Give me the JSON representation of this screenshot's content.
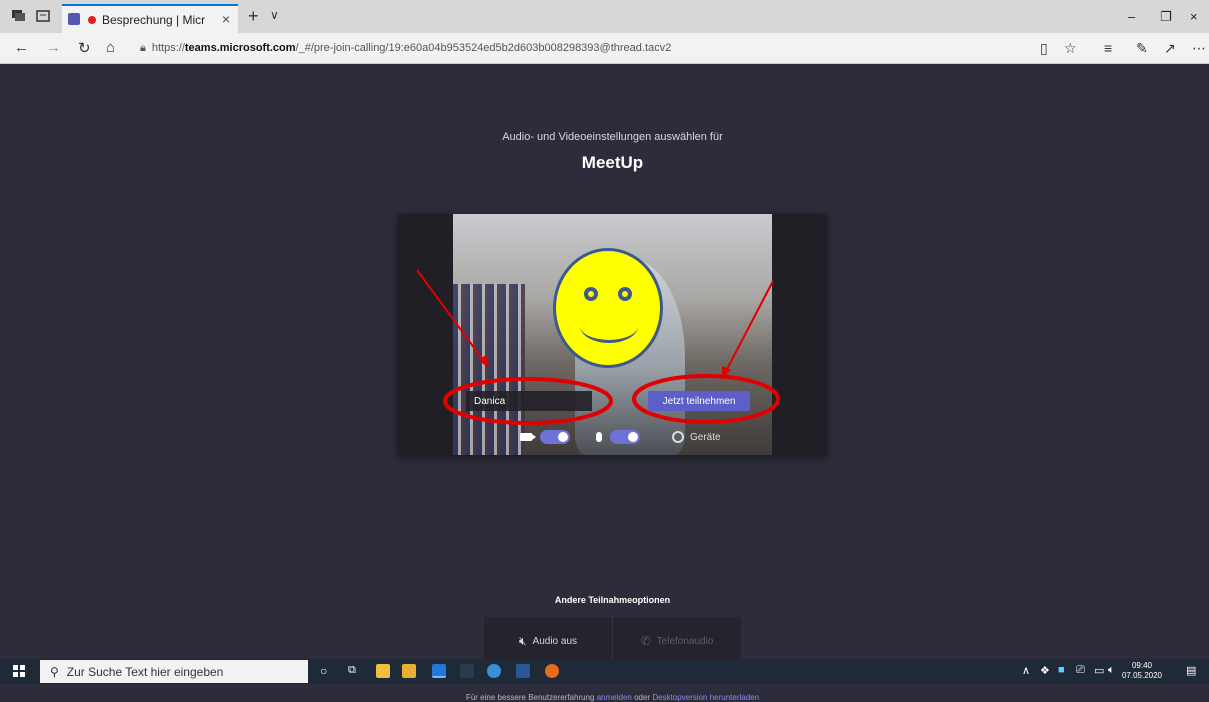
{
  "browser": {
    "tab_title": "Besprechung | Micr",
    "tab_close": "×",
    "new_tab": "+",
    "tab_list": "∨",
    "url_prefix": "https://",
    "url_domain": "teams.microsoft.com",
    "url_path": "/_#/pre-join-calling/19:e60a04b953524ed5b2d603b008298393@thread.tacv2",
    "window_controls": [
      "–",
      "❐",
      "×"
    ]
  },
  "prejoin": {
    "subtitle": "Audio- und Videoeinstellungen auswählen für",
    "meeting_name": "MeetUp",
    "name_value": "Danica",
    "join_label": "Jetzt teilnehmen",
    "devices_label": "Geräte",
    "camera_on": true,
    "mic_on": true
  },
  "other_options": {
    "title": "Andere Teilnahmeoptionen",
    "audio_off_label": "Audio aus",
    "phone_audio_label": "Telefonaudio"
  },
  "footer": {
    "text_before": "Für eine bessere Benutzererfahrung",
    "signin_link": "anmelden",
    "text_middle": "oder",
    "desktop_link": "Desktopversion herunterladen"
  },
  "taskbar": {
    "search_placeholder": "Zur Suche Text hier eingeben",
    "time": "09:40",
    "date": "07.05.2020"
  },
  "colors": {
    "page_bg": "#2d2c3a",
    "accent": "#5b5fc7",
    "annotation_red": "#e00000"
  }
}
